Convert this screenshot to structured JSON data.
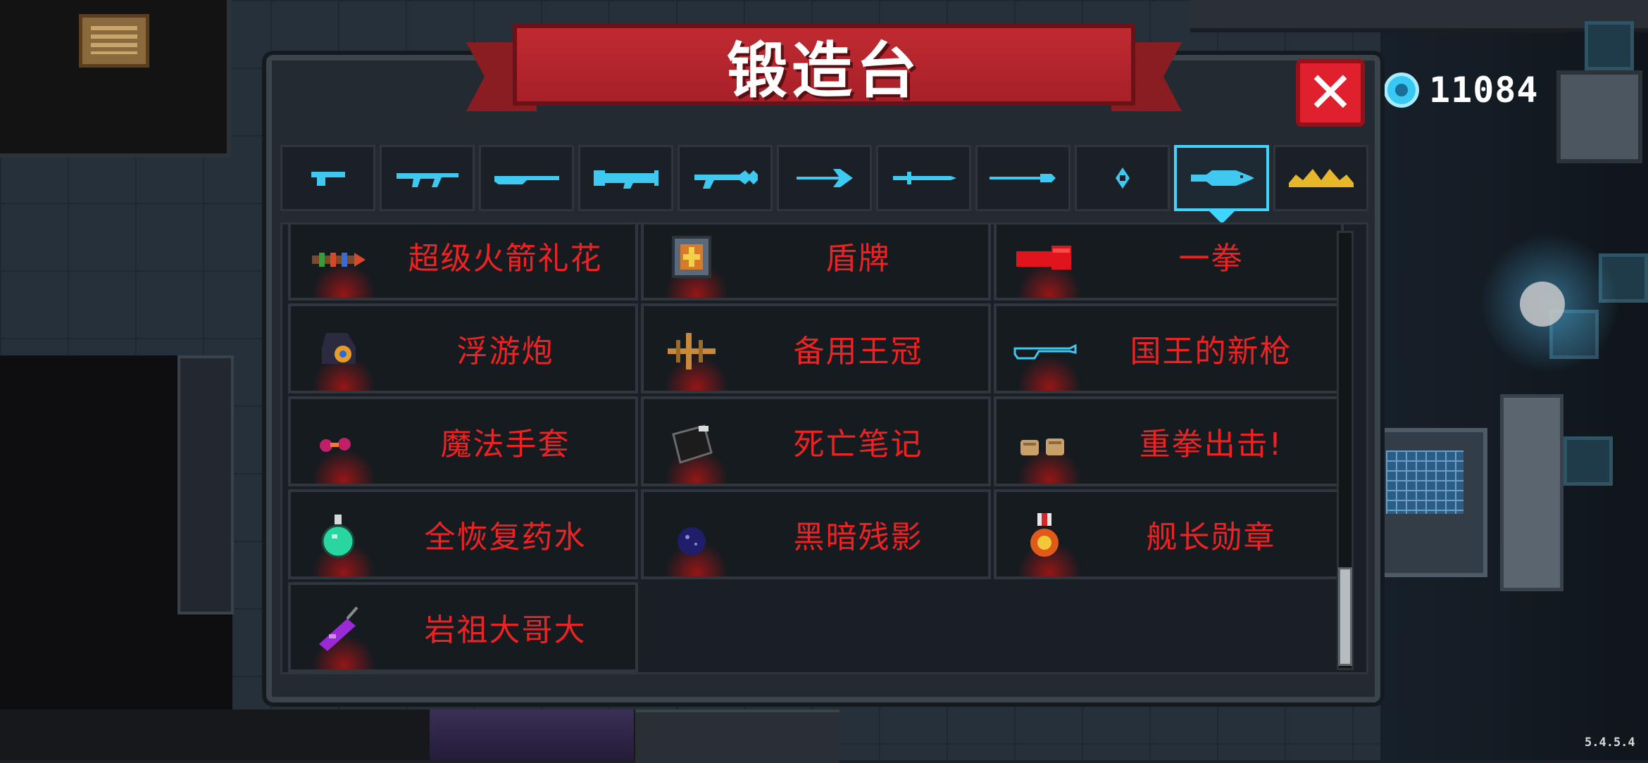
{
  "title": "锻造台",
  "currency": {
    "icon": "blue-gem-icon",
    "amount": "11084"
  },
  "close_icon": "close-x-icon",
  "tabs": [
    {
      "icon": "pistol-icon"
    },
    {
      "icon": "assault-rifle-icon"
    },
    {
      "icon": "shotgun-icon"
    },
    {
      "icon": "launcher-icon"
    },
    {
      "icon": "laser-rifle-icon"
    },
    {
      "icon": "bow-icon"
    },
    {
      "icon": "sword-icon"
    },
    {
      "icon": "staff-icon"
    },
    {
      "icon": "throwing-star-icon"
    },
    {
      "icon": "fish-item-icon",
      "selected": true
    },
    {
      "icon": "crown-icon"
    }
  ],
  "items": [
    {
      "name": "超级火箭礼花",
      "icon": "firework-rocket-icon"
    },
    {
      "name": "盾牌",
      "icon": "shield-icon"
    },
    {
      "name": "一拳",
      "icon": "red-fist-icon"
    },
    {
      "name": "浮游炮",
      "icon": "floating-cannon-icon"
    },
    {
      "name": "备用王冠",
      "icon": "spare-crown-icon"
    },
    {
      "name": "国王的新枪",
      "icon": "invisible-gun-icon"
    },
    {
      "name": "魔法手套",
      "icon": "magic-glove-icon"
    },
    {
      "name": "死亡笔记",
      "icon": "death-note-icon"
    },
    {
      "name": "重拳出击!",
      "icon": "power-punch-icon"
    },
    {
      "name": "全恢复药水",
      "icon": "healing-potion-icon"
    },
    {
      "name": "黑暗残影",
      "icon": "dark-orb-icon"
    },
    {
      "name": "舰长勋章",
      "icon": "captain-medal-icon"
    },
    {
      "name": "岩祖大哥大",
      "icon": "purple-phone-icon"
    }
  ],
  "version": "5.4.5.4",
  "colors": {
    "accent": "#3fd5ff",
    "item_name": "#ee2222",
    "banner": "#c02a31",
    "close": "#e0202c"
  }
}
